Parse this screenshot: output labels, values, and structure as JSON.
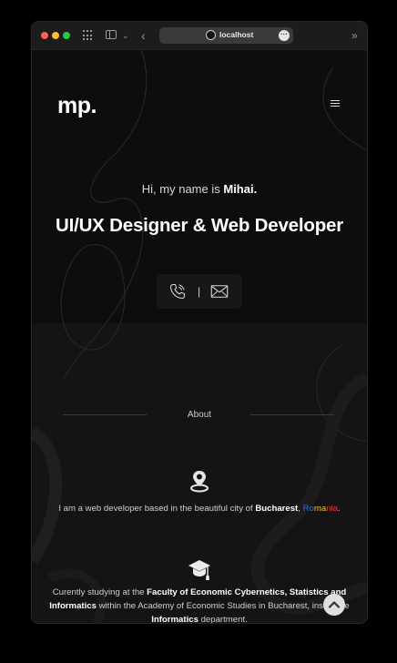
{
  "browser": {
    "url": "localhost",
    "icons": [
      "grid-icon",
      "sidebar-icon",
      "chevron-down-icon",
      "back-arrow-icon",
      "globe-icon",
      "more-icon",
      "double-chevron-icon"
    ]
  },
  "header": {
    "logo": "mp."
  },
  "hero": {
    "greeting_prefix": "Hi, my name is ",
    "name": "Mihai.",
    "role": "UI/UX Designer & Web Developer",
    "separator": "|"
  },
  "about": {
    "label": "About",
    "location_prefix": "I am a web developer based in the beautiful city of ",
    "city": "Bucharest",
    "comma": ", ",
    "country_parts": [
      "Ro",
      "ma",
      "nia"
    ],
    "period": ".",
    "edu_prefix": "Curently studying at the ",
    "faculty": "Faculty of Economic Cybernetics, Statistics and Informatics",
    "edu_mid": " within the Academy of Economic Studies in Bucharest, inside the ",
    "department": "Informatics",
    "edu_suffix": " department."
  },
  "colors": {
    "accent_blue": "#2f6ff0",
    "accent_yellow": "#f3c623",
    "accent_red": "#e53935"
  }
}
